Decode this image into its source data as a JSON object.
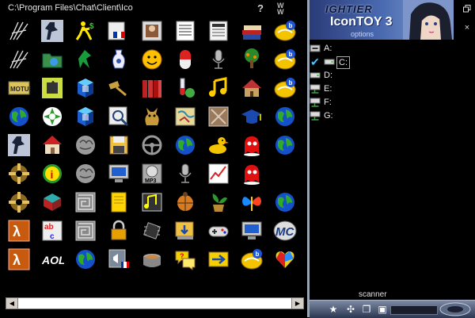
{
  "header": {
    "path": "C:\\Program Files\\Chat\\Client\\Ico",
    "help_label": "?",
    "logo_text": "W\nW"
  },
  "brand": {
    "line1": "IGHTIER",
    "line2": "IconTOY 3",
    "line3": "options"
  },
  "drives": [
    {
      "label": "A:",
      "icon": "floppy-drive-icon",
      "selected": false
    },
    {
      "label": "C:",
      "icon": "hard-drive-icon",
      "selected": true
    },
    {
      "label": "D:",
      "icon": "hard-drive-icon",
      "selected": false
    },
    {
      "label": "E:",
      "icon": "network-drive-icon",
      "selected": false
    },
    {
      "label": "F:",
      "icon": "network-drive-icon",
      "selected": false
    },
    {
      "label": "G:",
      "icon": "network-drive-icon",
      "selected": false
    }
  ],
  "bottom": {
    "scanner_label": "scanner",
    "progress": 0.0
  },
  "icons": [
    "sketch-icon",
    "counter-strike-icon",
    "dollar-runner-icon",
    "french-flag-icon",
    "portrait-icon",
    "news-icon",
    "newspaper-icon",
    "books-icon",
    "tv-b-icon",
    "sketch-icon",
    "folder-icon",
    "green-runner-icon",
    "vase-icon",
    "smiley-icon",
    "pill-icon",
    "microphone-icon",
    "tree-icon",
    "tv-b-icon",
    "motus-icon",
    "puzzle-icon",
    "cubes-icon",
    "gavel-icon",
    "book-shelf-icon",
    "test-tube-icon",
    "music-note-icon",
    "house-icon",
    "tv-b-icon",
    "globe-icon",
    "flower-icon",
    "cubes-icon",
    "magnifier-icon",
    "cat-icon",
    "map-icon",
    "cloth-icon",
    "graduation-cap-icon",
    "globe-icon",
    "counter-strike-icon",
    "home-icon",
    "brain-icon",
    "floppy-icon",
    "steering-wheel-icon",
    "globe-icon",
    "duck-icon",
    "red-ghost-icon",
    "globe-icon",
    "crosshair-icon",
    "info-icon",
    "brain-icon",
    "monitor-icon",
    "mp3-icon",
    "microphone-icon",
    "chart-icon",
    "red-ghost-icon",
    "",
    "crosshair-icon",
    "drum-icon",
    "maze-icon",
    "notepad-icon",
    "music-box-icon",
    "bug-icon",
    "plant-icon",
    "butterfly-icon",
    "globe-icon",
    "half-life-icon",
    "abc-icon",
    "maze-icon",
    "padlock-icon",
    "chip-icon",
    "download-icon",
    "gamepad-icon",
    "monitor-icon",
    "mc-icon",
    "half-life-icon",
    "aol-icon",
    "globe-icon",
    "audio-icon",
    "pot-icon",
    "chat-icon",
    "arrow-icon",
    "tv-b-icon",
    "puzzle-heart-icon"
  ],
  "colors": {
    "accent": "#2fa6ff",
    "background": "#000000",
    "panel": "#4a6ab0"
  }
}
